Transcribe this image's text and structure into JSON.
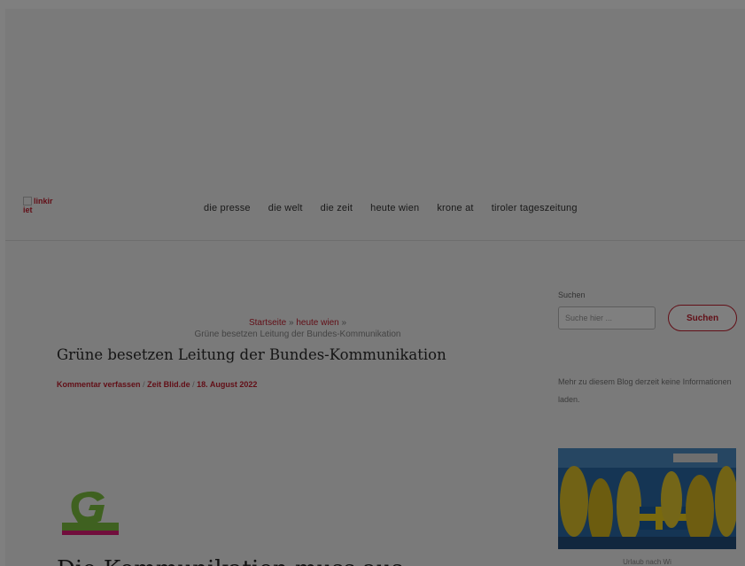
{
  "header": {
    "logo_alt": "linkir",
    "logo_text": "iet",
    "nav": [
      "die presse",
      "die welt",
      "die zeit",
      "heute wien",
      "krone at",
      "tiroler tageszeitung"
    ]
  },
  "breadcrumb": {
    "home": "Startseite",
    "separator": "»",
    "category": "heute wien",
    "current": "Grüne besetzen Leitung der Bundes-Kommunikation"
  },
  "article": {
    "title": "Grüne besetzen Leitung der Bundes-Kommunikation",
    "meta": {
      "comments": "Kommentar verfassen",
      "author": "Zeit Blid.de",
      "date": "18. August 2022",
      "separator": "/"
    },
    "heading_partial": "Die Kommunikation muss aus"
  },
  "sidebar": {
    "search_label": "Suchen",
    "search_placeholder": "Suche hier ...",
    "search_button": "Suchen",
    "info_text": "Mehr zu diesem Blog derzeit keine Informationen laden.",
    "image_caption": "Urlaub nach Wi"
  },
  "colors": {
    "accent": "#c41f2f",
    "overlay": "rgba(0,0,0,0.5)",
    "background": "#f4f4f4"
  }
}
